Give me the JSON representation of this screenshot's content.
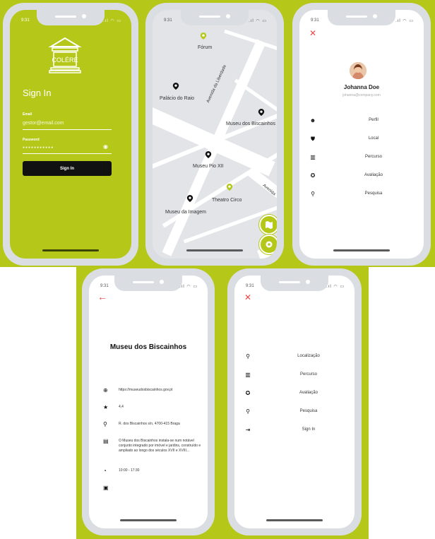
{
  "status": {
    "time": "9:31",
    "icons": ".ıl ◠ ▭"
  },
  "signin": {
    "logo_text": "COLÉRE",
    "title": "Sign In",
    "email_label": "Email",
    "email_value": "gestor@email.com",
    "password_label": "Password",
    "password_value": "●●●●●●●●●●●",
    "button": "Sign In"
  },
  "map": {
    "places": [
      "Fórum",
      "Palácio do Raio",
      "Museu dos Biscainhos",
      "Museu Pio XII",
      "Theatro Circo",
      "Museu da Imagem"
    ],
    "streets": [
      "Avenida da Liberdade",
      "Avenida"
    ]
  },
  "profile_menu": {
    "name": "Johanna Doe",
    "email": "johanna@company.com",
    "items": [
      "Perfil",
      "Local",
      "Percurso",
      "Avaliação",
      "Pesquisa"
    ]
  },
  "detail": {
    "title": "Museu dos Biscainhos",
    "url": "https://museudosbiscainhos.gov.pt",
    "rating": "4,4",
    "address": "R. dos Biscainhos s/n, 4700-415 Braga",
    "description": "O Museu dos Biscainhos instala-se num notável conjunto integrado por imóvel e jardins, construído e ampliado ao longo dos séculos XVII e XVIII...",
    "hours": "10:00 - 17:30"
  },
  "guest_menu": {
    "items": [
      "Localização",
      "Percurso",
      "Avaliação",
      "Pesquisa",
      "Sign In"
    ]
  },
  "colors": {
    "accent": "#b5c81a",
    "close": "#e44444"
  }
}
